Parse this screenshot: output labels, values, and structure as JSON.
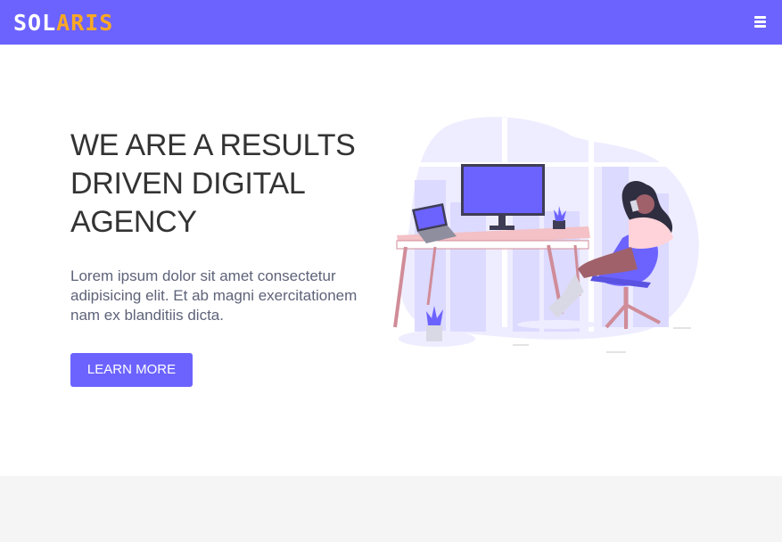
{
  "brand": {
    "logo_part1": "SOL",
    "logo_part2": "ARIS",
    "primary_color": "#6c63ff",
    "accent_color": "#f9a825"
  },
  "navbar": {
    "menu_icon": "hamburger-icon"
  },
  "hero": {
    "title_line1": "WE ARE A RESULTS",
    "title_line2": "DRIVEN DIGITAL",
    "title_line3": "AGENCY",
    "description": "Lorem ipsum dolor sit amet consectetur adipisicing elit. Et ab magni exercitationem nam ex blanditiis dicta.",
    "cta_label": "LEARN MORE"
  }
}
